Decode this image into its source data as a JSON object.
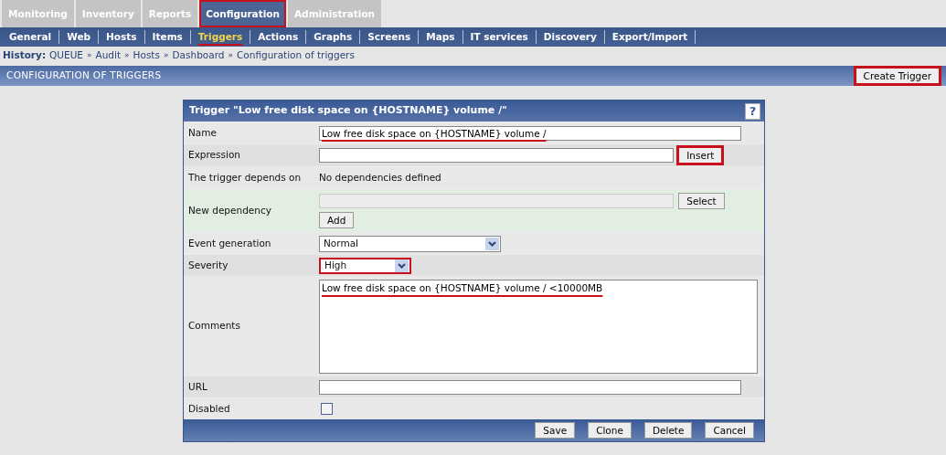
{
  "top_tabs": [
    {
      "label": "Monitoring",
      "selected": false,
      "marked": false
    },
    {
      "label": "Inventory",
      "selected": false,
      "marked": false
    },
    {
      "label": "Reports",
      "selected": false,
      "marked": false
    },
    {
      "label": "Configuration",
      "selected": true,
      "marked": true
    },
    {
      "label": "Administration",
      "selected": false,
      "marked": false
    }
  ],
  "sub_nav": [
    {
      "label": "General",
      "selected": false,
      "underlined": false
    },
    {
      "label": "Web",
      "selected": false,
      "underlined": false
    },
    {
      "label": "Hosts",
      "selected": false,
      "underlined": false
    },
    {
      "label": "Items",
      "selected": false,
      "underlined": false
    },
    {
      "label": "Triggers",
      "selected": true,
      "underlined": true
    },
    {
      "label": "Actions",
      "selected": false,
      "underlined": false
    },
    {
      "label": "Graphs",
      "selected": false,
      "underlined": false
    },
    {
      "label": "Screens",
      "selected": false,
      "underlined": false
    },
    {
      "label": "Maps",
      "selected": false,
      "underlined": false
    },
    {
      "label": "IT services",
      "selected": false,
      "underlined": false
    },
    {
      "label": "Discovery",
      "selected": false,
      "underlined": false
    },
    {
      "label": "Export/Import",
      "selected": false,
      "underlined": false
    }
  ],
  "history": {
    "label": "History:",
    "separator": "»",
    "items": [
      "QUEUE",
      "Audit",
      "Hosts",
      "Dashboard",
      "Configuration of triggers"
    ]
  },
  "page_header": {
    "title": "CONFIGURATION OF TRIGGERS",
    "button": {
      "label": "Create Trigger",
      "marked": true
    }
  },
  "form": {
    "title": "Trigger \"Low free disk space on {HOSTNAME} volume /\"",
    "help": "?",
    "rows": [
      {
        "kind": "text",
        "label": "Name",
        "value": "Low free disk space on {HOSTNAME} volume /",
        "underlined": true
      },
      {
        "kind": "text_button",
        "label": "Expression",
        "button": {
          "label": "Insert",
          "marked": true
        }
      },
      {
        "kind": "static",
        "label": "The trigger depends on",
        "value": "No dependencies defined"
      },
      {
        "kind": "dependency",
        "label": "New dependency",
        "buttons": [
          "Select",
          "Add"
        ]
      },
      {
        "kind": "select",
        "label": "Event generation",
        "value": "Normal",
        "marked": false
      },
      {
        "kind": "select",
        "label": "Severity",
        "value": "High",
        "marked": true
      },
      {
        "kind": "textarea",
        "label": "Comments",
        "value": "Low free disk space on {HOSTNAME} volume / <10000MB",
        "underlined": true
      },
      {
        "kind": "text",
        "label": "URL"
      },
      {
        "kind": "checkbox",
        "label": "Disabled",
        "checked": false
      }
    ],
    "buttons": [
      "Save",
      "Clone",
      "Delete",
      "Cancel"
    ]
  }
}
